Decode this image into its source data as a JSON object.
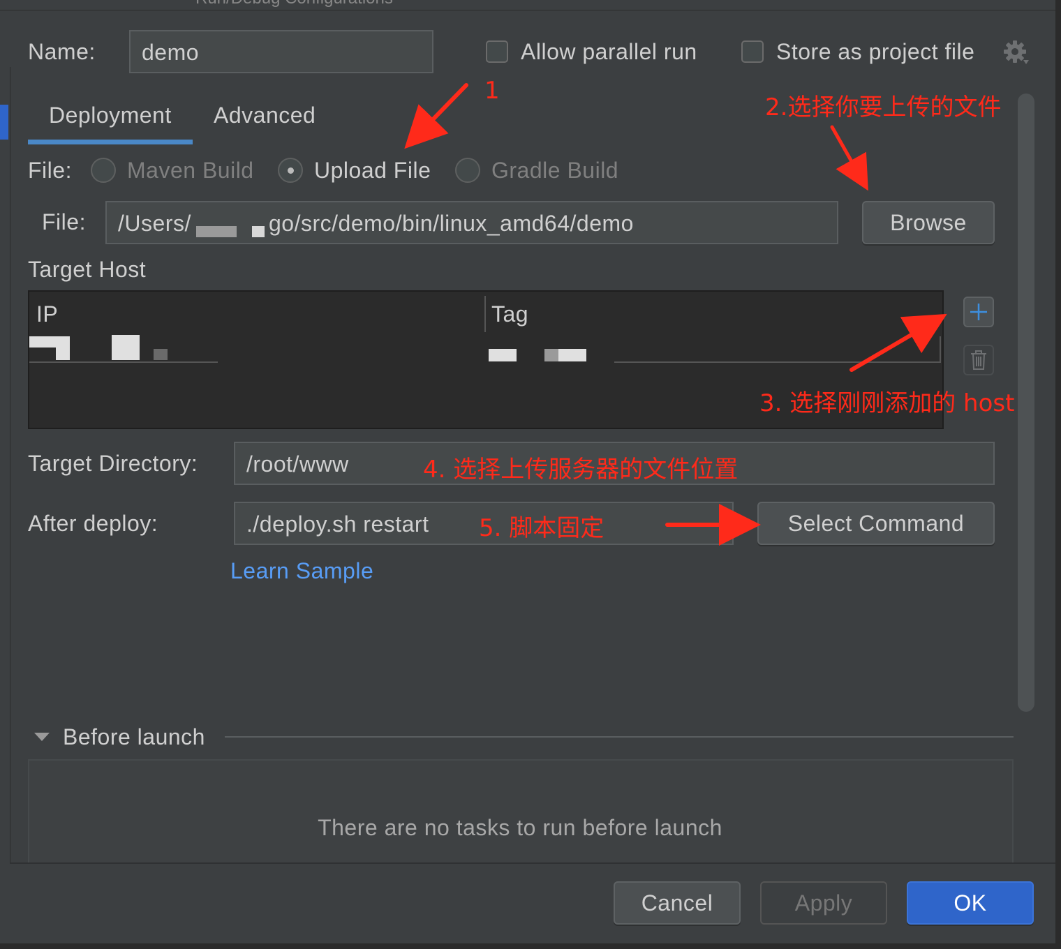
{
  "window": {
    "title": "Run/Debug Configurations"
  },
  "header": {
    "name_label": "Name:",
    "name_value": "demo",
    "allow_parallel_label": "Allow parallel run",
    "store_project_label": "Store as project file",
    "settings_icon": "gear-icon"
  },
  "tabs": [
    {
      "label": "Deployment",
      "active": true
    },
    {
      "label": "Advanced",
      "active": false
    }
  ],
  "file_type": {
    "label": "File:",
    "options": [
      {
        "label": "Maven Build",
        "selected": false,
        "enabled": false
      },
      {
        "label": "Upload File",
        "selected": true,
        "enabled": true
      },
      {
        "label": "Gradle Build",
        "selected": false,
        "enabled": false
      }
    ]
  },
  "file_path": {
    "label": "File:",
    "value_prefix": "/Users/",
    "value_suffix": "go/src/demo/bin/linux_amd64/demo",
    "browse_label": "Browse"
  },
  "target_host": {
    "label": "Target Host",
    "columns": [
      "IP",
      "Tag"
    ],
    "add_icon": "plus-icon",
    "delete_icon": "trash-icon"
  },
  "target_directory": {
    "label": "Target Directory:",
    "value": "/root/www"
  },
  "after_deploy": {
    "label": "After deploy:",
    "value": "./deploy.sh restart",
    "select_command_label": "Select Command"
  },
  "learn_sample": "Learn Sample",
  "before_launch": {
    "title": "Before launch",
    "empty_text": "There are no tasks to run before launch"
  },
  "footer": {
    "cancel": "Cancel",
    "apply": "Apply",
    "ok": "OK"
  },
  "annotations": {
    "a1": "1",
    "a2": "2.选择你要上传的文件",
    "a3": "3. 选择刚刚添加的 host",
    "a4": "4. 选择上传服务器的文件位置",
    "a5": "5. 脚本固定"
  },
  "colors": {
    "accent": "#2f65ca",
    "annotation": "#ff2a1a",
    "link": "#589df6"
  }
}
